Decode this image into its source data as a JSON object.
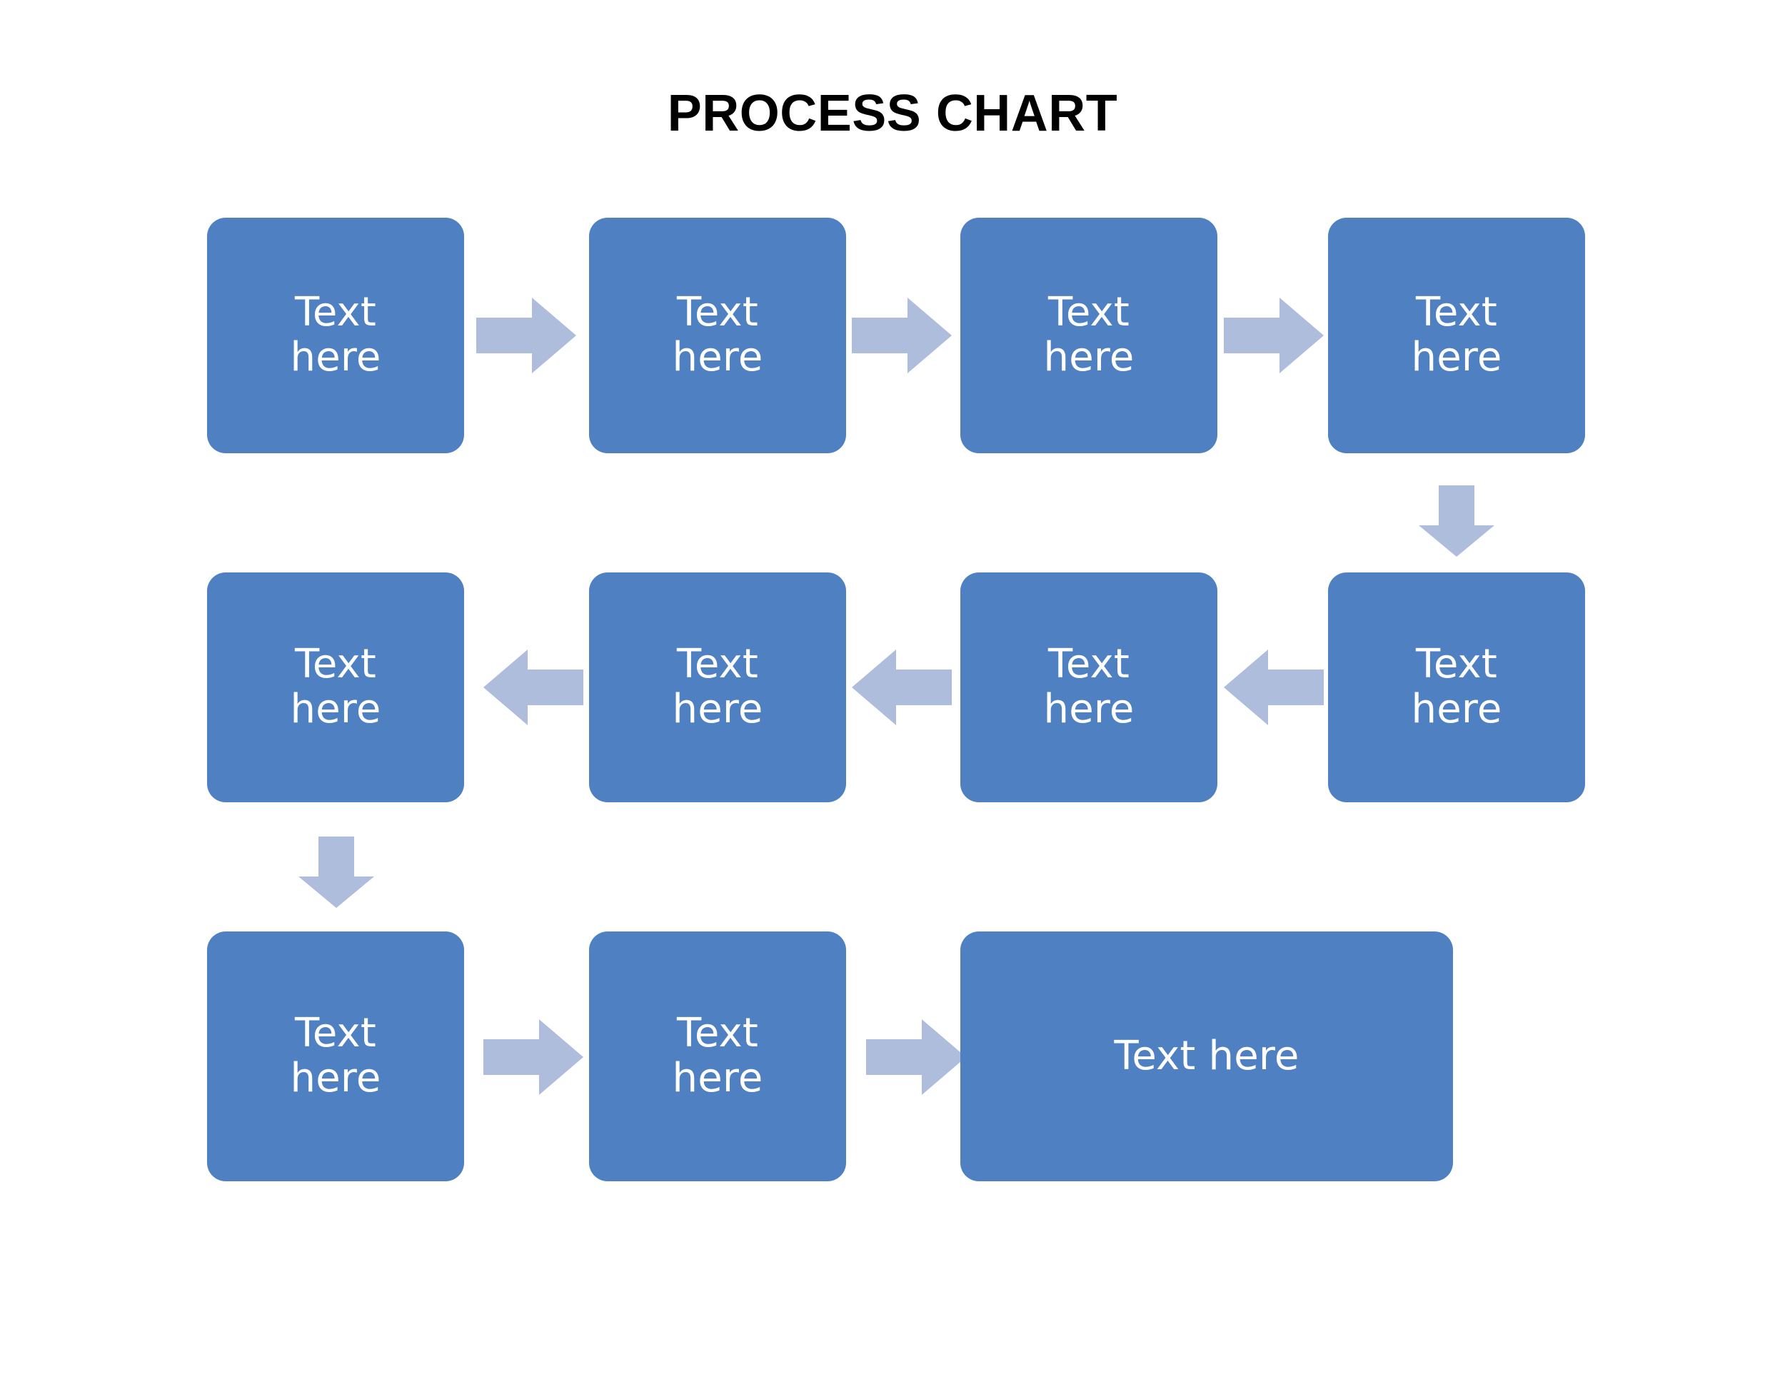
{
  "title": "PROCESS CHART",
  "colors": {
    "box_fill": "#4E80C2",
    "box_text": "#FFFFFF",
    "arrow_fill": "#AEBDDB",
    "background": "#FFFFFF",
    "title_text": "#000000"
  },
  "chart_data": {
    "type": "diagram",
    "title": "PROCESS CHART",
    "flow_direction": "serpentine: row1 left-to-right, row2 right-to-left, row3 left-to-right",
    "nodes": [
      {
        "id": "n1",
        "row": 1,
        "col": 1,
        "label": "Text\nhere",
        "shape": "rounded-rect"
      },
      {
        "id": "n2",
        "row": 1,
        "col": 2,
        "label": "Text\nhere",
        "shape": "rounded-rect"
      },
      {
        "id": "n3",
        "row": 1,
        "col": 3,
        "label": "Text\nhere",
        "shape": "rounded-rect"
      },
      {
        "id": "n4",
        "row": 1,
        "col": 4,
        "label": "Text\nhere",
        "shape": "rounded-rect"
      },
      {
        "id": "n5",
        "row": 2,
        "col": 4,
        "label": "Text\nhere",
        "shape": "rounded-rect"
      },
      {
        "id": "n6",
        "row": 2,
        "col": 3,
        "label": "Text\nhere",
        "shape": "rounded-rect"
      },
      {
        "id": "n7",
        "row": 2,
        "col": 2,
        "label": "Text\nhere",
        "shape": "rounded-rect"
      },
      {
        "id": "n8",
        "row": 2,
        "col": 1,
        "label": "Text\nhere",
        "shape": "rounded-rect"
      },
      {
        "id": "n9",
        "row": 3,
        "col": 1,
        "label": "Text\nhere",
        "shape": "rounded-rect"
      },
      {
        "id": "n10",
        "row": 3,
        "col": 2,
        "label": "Text\nhere",
        "shape": "rounded-rect"
      },
      {
        "id": "n11",
        "row": 3,
        "col": 3,
        "label": "Text here",
        "shape": "rounded-rect-wide"
      }
    ],
    "connectors": [
      {
        "from": "n1",
        "to": "n2",
        "direction": "right"
      },
      {
        "from": "n2",
        "to": "n3",
        "direction": "right"
      },
      {
        "from": "n3",
        "to": "n4",
        "direction": "right"
      },
      {
        "from": "n4",
        "to": "n5",
        "direction": "down"
      },
      {
        "from": "n5",
        "to": "n6",
        "direction": "left"
      },
      {
        "from": "n6",
        "to": "n7",
        "direction": "left"
      },
      {
        "from": "n7",
        "to": "n8",
        "direction": "left"
      },
      {
        "from": "n8",
        "to": "n9",
        "direction": "down"
      },
      {
        "from": "n9",
        "to": "n10",
        "direction": "right"
      },
      {
        "from": "n10",
        "to": "n11",
        "direction": "right"
      }
    ]
  },
  "boxes": {
    "r1c1": "Text\nhere",
    "r1c2": "Text\nhere",
    "r1c3": "Text\nhere",
    "r1c4": "Text\nhere",
    "r2c4": "Text\nhere",
    "r2c3": "Text\nhere",
    "r2c2": "Text\nhere",
    "r2c1": "Text\nhere",
    "r3c1": "Text\nhere",
    "r3c2": "Text\nhere",
    "r3c3": "Text here"
  },
  "icons": {
    "arrow_right": "arrow-right-icon",
    "arrow_left": "arrow-left-icon",
    "arrow_down": "arrow-down-icon"
  }
}
